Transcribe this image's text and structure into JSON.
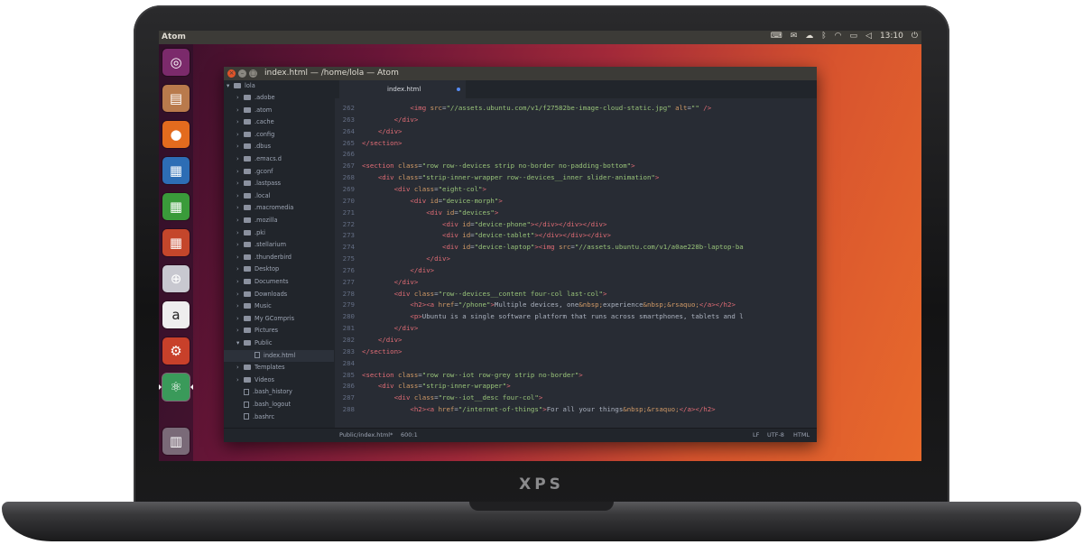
{
  "device": {
    "brand": "XPS"
  },
  "panel": {
    "app_title": "Atom",
    "clock": "13:10",
    "tray_icons": [
      "keyboard-icon",
      "mail-icon",
      "cloud-icon",
      "bluetooth-icon",
      "wifi-icon",
      "battery-icon",
      "volume-icon",
      "clock",
      "power-icon"
    ]
  },
  "launcher": {
    "items": [
      {
        "name": "ubuntu-dash-icon",
        "glyph": "◎",
        "bg": "#7b2a6b"
      },
      {
        "name": "files-icon",
        "glyph": "▤",
        "bg": "#b97a4c"
      },
      {
        "name": "firefox-icon",
        "glyph": "●",
        "bg": "#e36b1e"
      },
      {
        "name": "writer-icon",
        "glyph": "▦",
        "bg": "#2d6db5"
      },
      {
        "name": "calc-icon",
        "glyph": "▦",
        "bg": "#3a9b3a"
      },
      {
        "name": "impress-icon",
        "glyph": "▦",
        "bg": "#c4462b"
      },
      {
        "name": "software-center-icon",
        "glyph": "⊕",
        "bg": "#c8c8d0"
      },
      {
        "name": "amazon-icon",
        "glyph": "a",
        "bg": "#eeeeee"
      },
      {
        "name": "system-settings-icon",
        "glyph": "⚙",
        "bg": "#c8402a"
      },
      {
        "name": "atom-icon",
        "glyph": "⚛",
        "bg": "#3a9a5a"
      },
      {
        "name": "trash-icon",
        "glyph": "▥",
        "bg": "#7a6a78"
      }
    ]
  },
  "window": {
    "title": "index.html — /home/lola — Atom"
  },
  "tree": {
    "root": "lola",
    "items": [
      {
        "label": ".adobe",
        "type": "folder"
      },
      {
        "label": ".atom",
        "type": "folder"
      },
      {
        "label": ".cache",
        "type": "folder"
      },
      {
        "label": ".config",
        "type": "folder"
      },
      {
        "label": ".dbus",
        "type": "folder"
      },
      {
        "label": ".emacs.d",
        "type": "folder"
      },
      {
        "label": ".gconf",
        "type": "folder"
      },
      {
        "label": ".lastpass",
        "type": "folder"
      },
      {
        "label": ".local",
        "type": "folder"
      },
      {
        "label": ".macromedia",
        "type": "folder"
      },
      {
        "label": ".mozilla",
        "type": "folder"
      },
      {
        "label": ".pki",
        "type": "folder"
      },
      {
        "label": ".stellarium",
        "type": "folder"
      },
      {
        "label": ".thunderbird",
        "type": "folder"
      },
      {
        "label": "Desktop",
        "type": "folder"
      },
      {
        "label": "Documents",
        "type": "folder"
      },
      {
        "label": "Downloads",
        "type": "folder"
      },
      {
        "label": "Music",
        "type": "folder"
      },
      {
        "label": "My GCompris",
        "type": "folder"
      },
      {
        "label": "Pictures",
        "type": "folder"
      },
      {
        "label": "Public",
        "type": "open-folder"
      },
      {
        "label": "index.html",
        "type": "file",
        "selected": true
      },
      {
        "label": "Templates",
        "type": "folder"
      },
      {
        "label": "Videos",
        "type": "folder"
      },
      {
        "label": ".bash_history",
        "type": "file"
      },
      {
        "label": ".bash_logout",
        "type": "file"
      },
      {
        "label": ".bashrc",
        "type": "file"
      }
    ]
  },
  "editor": {
    "tab": "index.html",
    "lines": [
      {
        "n": "262",
        "segs": [
          [
            "tx",
            "            "
          ],
          [
            "tg",
            "<img "
          ],
          [
            "at",
            "src"
          ],
          [
            "tx",
            "="
          ],
          [
            "st",
            "\"//assets.ubuntu.com/v1/f27582be-image-cloud-static.jpg\""
          ],
          [
            "tx",
            " "
          ],
          [
            "at",
            "alt"
          ],
          [
            "tx",
            "="
          ],
          [
            "st",
            "\"\""
          ],
          [
            "tg",
            " />"
          ]
        ]
      },
      {
        "n": "263",
        "segs": [
          [
            "tx",
            "        "
          ],
          [
            "tg",
            "</div>"
          ]
        ]
      },
      {
        "n": "264",
        "segs": [
          [
            "tx",
            "    "
          ],
          [
            "tg",
            "</div>"
          ]
        ]
      },
      {
        "n": "265",
        "segs": [
          [
            "tg",
            "</section>"
          ]
        ]
      },
      {
        "n": "266",
        "segs": []
      },
      {
        "n": "267",
        "segs": [
          [
            "tg",
            "<section "
          ],
          [
            "at",
            "class"
          ],
          [
            "tx",
            "="
          ],
          [
            "st",
            "\"row row--devices strip no-border no-padding-bottom\""
          ],
          [
            "tg",
            ">"
          ]
        ]
      },
      {
        "n": "268",
        "segs": [
          [
            "tx",
            "    "
          ],
          [
            "tg",
            "<div "
          ],
          [
            "at",
            "class"
          ],
          [
            "tx",
            "="
          ],
          [
            "st",
            "\"strip-inner-wrapper row--devices__inner slider-animation\""
          ],
          [
            "tg",
            ">"
          ]
        ]
      },
      {
        "n": "269",
        "segs": [
          [
            "tx",
            "        "
          ],
          [
            "tg",
            "<div "
          ],
          [
            "at",
            "class"
          ],
          [
            "tx",
            "="
          ],
          [
            "st",
            "\"eight-col\""
          ],
          [
            "tg",
            ">"
          ]
        ]
      },
      {
        "n": "270",
        "segs": [
          [
            "tx",
            "            "
          ],
          [
            "tg",
            "<div "
          ],
          [
            "at",
            "id"
          ],
          [
            "tx",
            "="
          ],
          [
            "st",
            "\"device-morph\""
          ],
          [
            "tg",
            ">"
          ]
        ]
      },
      {
        "n": "271",
        "segs": [
          [
            "tx",
            "                "
          ],
          [
            "tg",
            "<div "
          ],
          [
            "at",
            "id"
          ],
          [
            "tx",
            "="
          ],
          [
            "st",
            "\"devices\""
          ],
          [
            "tg",
            ">"
          ]
        ]
      },
      {
        "n": "272",
        "segs": [
          [
            "tx",
            "                    "
          ],
          [
            "tg",
            "<div "
          ],
          [
            "at",
            "id"
          ],
          [
            "tx",
            "="
          ],
          [
            "st",
            "\"device-phone\""
          ],
          [
            "tg",
            "></div></div></div>"
          ]
        ]
      },
      {
        "n": "273",
        "segs": [
          [
            "tx",
            "                    "
          ],
          [
            "tg",
            "<div "
          ],
          [
            "at",
            "id"
          ],
          [
            "tx",
            "="
          ],
          [
            "st",
            "\"device-tablet\""
          ],
          [
            "tg",
            "></div></div></div>"
          ]
        ]
      },
      {
        "n": "274",
        "segs": [
          [
            "tx",
            "                    "
          ],
          [
            "tg",
            "<div "
          ],
          [
            "at",
            "id"
          ],
          [
            "tx",
            "="
          ],
          [
            "st",
            "\"device-laptop\""
          ],
          [
            "tg",
            "><img "
          ],
          [
            "at",
            "src"
          ],
          [
            "tx",
            "="
          ],
          [
            "st",
            "\"//assets.ubuntu.com/v1/a0ae228b-laptop-ba"
          ]
        ]
      },
      {
        "n": "275",
        "segs": [
          [
            "tx",
            "                "
          ],
          [
            "tg",
            "</div>"
          ]
        ]
      },
      {
        "n": "276",
        "segs": [
          [
            "tx",
            "            "
          ],
          [
            "tg",
            "</div>"
          ]
        ]
      },
      {
        "n": "277",
        "segs": [
          [
            "tx",
            "        "
          ],
          [
            "tg",
            "</div>"
          ]
        ]
      },
      {
        "n": "278",
        "segs": [
          [
            "tx",
            "        "
          ],
          [
            "tg",
            "<div "
          ],
          [
            "at",
            "class"
          ],
          [
            "tx",
            "="
          ],
          [
            "st",
            "\"row--devices__content four-col last-col\""
          ],
          [
            "tg",
            ">"
          ]
        ]
      },
      {
        "n": "279",
        "segs": [
          [
            "tx",
            "            "
          ],
          [
            "tg",
            "<h2><a "
          ],
          [
            "at",
            "href"
          ],
          [
            "tx",
            "="
          ],
          [
            "st",
            "\"/phone\""
          ],
          [
            "tg",
            ">"
          ],
          [
            "tx",
            "Multiple devices, one"
          ],
          [
            "at",
            "&nbsp;"
          ],
          [
            "tx",
            "experience"
          ],
          [
            "at",
            "&nbsp;&rsaquo;"
          ],
          [
            "tg",
            "</a></h2>"
          ]
        ]
      },
      {
        "n": "280",
        "segs": [
          [
            "tx",
            "            "
          ],
          [
            "tg",
            "<p>"
          ],
          [
            "tx",
            "Ubuntu is a single software platform that runs across smartphones, tablets and l"
          ]
        ]
      },
      {
        "n": "281",
        "segs": [
          [
            "tx",
            "        "
          ],
          [
            "tg",
            "</div>"
          ]
        ]
      },
      {
        "n": "282",
        "segs": [
          [
            "tx",
            "    "
          ],
          [
            "tg",
            "</div>"
          ]
        ]
      },
      {
        "n": "283",
        "segs": [
          [
            "tg",
            "</section>"
          ]
        ]
      },
      {
        "n": "284",
        "segs": []
      },
      {
        "n": "285",
        "segs": [
          [
            "tg",
            "<section "
          ],
          [
            "at",
            "class"
          ],
          [
            "tx",
            "="
          ],
          [
            "st",
            "\"row row--iot row-grey strip no-border\""
          ],
          [
            "tg",
            ">"
          ]
        ]
      },
      {
        "n": "286",
        "segs": [
          [
            "tx",
            "    "
          ],
          [
            "tg",
            "<div "
          ],
          [
            "at",
            "class"
          ],
          [
            "tx",
            "="
          ],
          [
            "st",
            "\"strip-inner-wrapper\""
          ],
          [
            "tg",
            ">"
          ]
        ]
      },
      {
        "n": "287",
        "segs": [
          [
            "tx",
            "        "
          ],
          [
            "tg",
            "<div "
          ],
          [
            "at",
            "class"
          ],
          [
            "tx",
            "="
          ],
          [
            "st",
            "\"row--iot__desc four-col\""
          ],
          [
            "tg",
            ">"
          ]
        ]
      },
      {
        "n": "288",
        "segs": [
          [
            "tx",
            "            "
          ],
          [
            "tg",
            "<h2><a "
          ],
          [
            "at",
            "href"
          ],
          [
            "tx",
            "="
          ],
          [
            "st",
            "\"/internet-of-things\""
          ],
          [
            "tg",
            ">"
          ],
          [
            "tx",
            "For all your things"
          ],
          [
            "at",
            "&nbsp;&rsaquo;"
          ],
          [
            "tg",
            "</a></h2>"
          ]
        ]
      }
    ]
  },
  "status": {
    "path": "Public/index.html*",
    "cursor": "600:1",
    "line_ending": "LF",
    "encoding": "UTF-8",
    "grammar": "HTML"
  }
}
